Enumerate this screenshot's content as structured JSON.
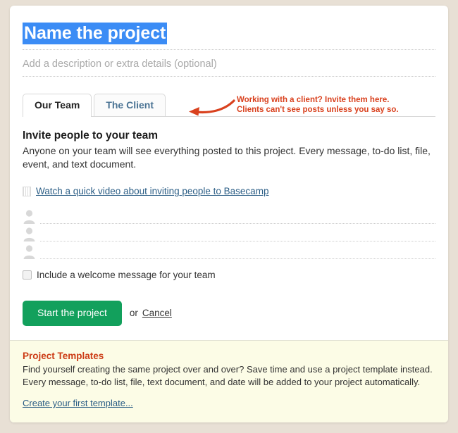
{
  "form": {
    "title_value": "Name the project",
    "description_placeholder": "Add a description or extra details (optional)"
  },
  "tabs": [
    {
      "label": "Our Team",
      "active": true
    },
    {
      "label": "The Client",
      "active": false
    }
  ],
  "annotation": {
    "line1": "Working with a client? Invite them here.",
    "line2": "Clients can't see posts unless you say so.",
    "color": "#d9411e",
    "arrow_icon": "curved-left-arrow-icon"
  },
  "invite": {
    "heading": "Invite people to your team",
    "paragraph": "Anyone on your team will see everything posted to this project. Every message, to-do list, file, event, and text document.",
    "video_icon": "film-strip-icon",
    "video_link": "Watch a quick video about inviting people to Basecamp",
    "person_icon": "person-avatar-icon",
    "rows": [
      {
        "value": "",
        "placeholder": ""
      },
      {
        "value": "",
        "placeholder": ""
      },
      {
        "value": "",
        "placeholder": ""
      }
    ],
    "welcome_checkbox_label": "Include a welcome message for your team",
    "welcome_checkbox_checked": false
  },
  "actions": {
    "submit_label": "Start the project",
    "or_text": "or",
    "cancel_label": "Cancel",
    "submit_color": "#12a05c"
  },
  "footer": {
    "heading": "Project Templates",
    "heading_color": "#cc3c16",
    "paragraph": "Find yourself creating the same project over and over? Save time and use a project template instead. Every message, to-do list, file, text document, and date will be added to your project automatically.",
    "link": "Create your first template...",
    "background": "#fcfce6"
  },
  "colors": {
    "page_background": "#e8e0d5",
    "card_background": "#ffffff",
    "selection_highlight": "#3b8cf5"
  }
}
